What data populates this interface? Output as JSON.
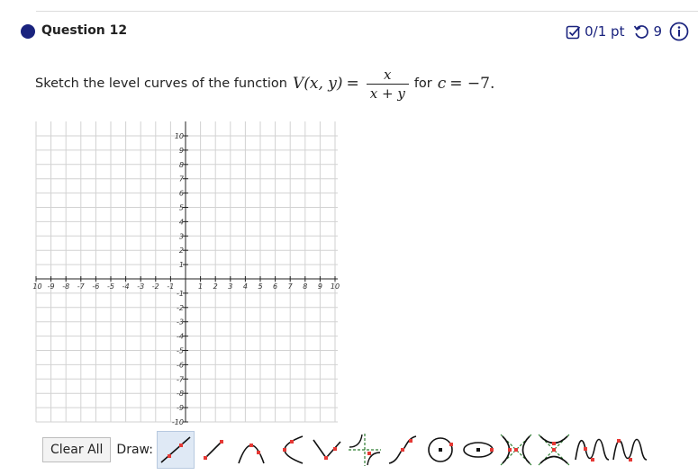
{
  "header": {
    "question_title": "Question 12",
    "score_text": "0/1 pt",
    "attempts_text": "9",
    "icons": [
      "status-dot-icon",
      "checkbox-icon",
      "retry-icon",
      "info-icon"
    ],
    "accent_color": "#1a237e"
  },
  "prompt": {
    "lead_text": "Sketch the level curves of the function",
    "function_lhs": "V(x, y)",
    "equals": "=",
    "numerator": "x",
    "denominator": "x + y",
    "tail_prefix": "for",
    "tail_var": "c",
    "tail_value": "= −7."
  },
  "graph": {
    "x_ticks": [
      "-10",
      "-9",
      "-8",
      "-7",
      "-6",
      "-5",
      "-4",
      "-3",
      "-2",
      "-1",
      "1",
      "2",
      "3",
      "4",
      "5",
      "6",
      "7",
      "8",
      "9",
      "10"
    ],
    "y_ticks": [
      "10",
      "9",
      "8",
      "7",
      "6",
      "5",
      "4",
      "3",
      "2",
      "1",
      "-1",
      "-2",
      "-3",
      "-4",
      "-5",
      "-6",
      "-7",
      "-8",
      "-9",
      "-10"
    ],
    "x_range": [
      -10,
      10
    ],
    "y_range": [
      -10,
      10
    ],
    "grid": true
  },
  "toolbar": {
    "clear_label": "Clear All",
    "draw_label": "Draw:",
    "tools": [
      {
        "name": "line-tool-icon"
      },
      {
        "name": "segment-tool-icon"
      },
      {
        "name": "parabola-tool-icon"
      },
      {
        "name": "sideways-parabola-tool-icon"
      },
      {
        "name": "absolute-value-tool-icon"
      },
      {
        "name": "rational-tool-icon"
      },
      {
        "name": "cubic-tool-icon"
      },
      {
        "name": "circle-tool-icon"
      },
      {
        "name": "ellipse-tool-icon"
      },
      {
        "name": "hyperbola-tool-icon"
      },
      {
        "name": "vertical-hyperbola-tool-icon"
      },
      {
        "name": "sine-tool-icon"
      },
      {
        "name": "cosine-tool-icon"
      }
    ]
  }
}
